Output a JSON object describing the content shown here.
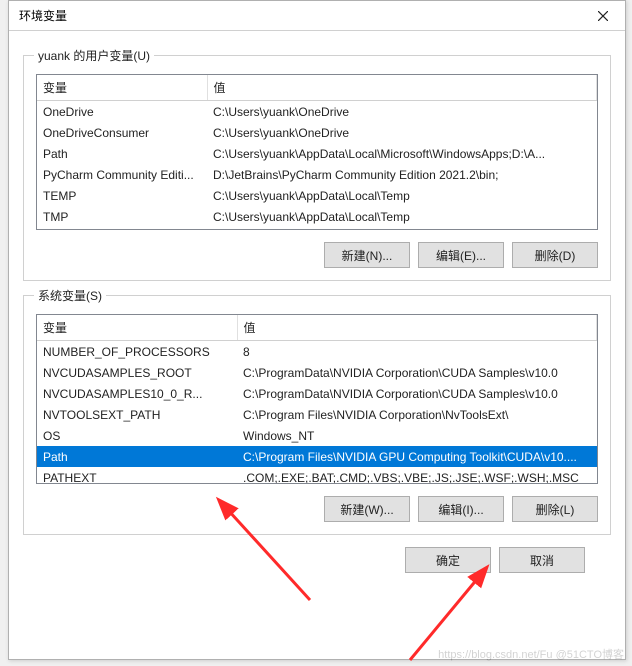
{
  "titlebar": {
    "title": "环境变量"
  },
  "userGroup": {
    "label": "yuank 的用户变量(U)",
    "headers": {
      "var": "变量",
      "val": "值"
    },
    "rows": [
      {
        "var": "OneDrive",
        "val": "C:\\Users\\yuank\\OneDrive"
      },
      {
        "var": "OneDriveConsumer",
        "val": "C:\\Users\\yuank\\OneDrive"
      },
      {
        "var": "Path",
        "val": "C:\\Users\\yuank\\AppData\\Local\\Microsoft\\WindowsApps;D:\\A..."
      },
      {
        "var": "PyCharm Community Editi...",
        "val": "D:\\JetBrains\\PyCharm Community Edition 2021.2\\bin;"
      },
      {
        "var": "TEMP",
        "val": "C:\\Users\\yuank\\AppData\\Local\\Temp"
      },
      {
        "var": "TMP",
        "val": "C:\\Users\\yuank\\AppData\\Local\\Temp"
      }
    ],
    "buttons": {
      "new": "新建(N)...",
      "edit": "编辑(E)...",
      "del": "删除(D)"
    }
  },
  "sysGroup": {
    "label": "系统变量(S)",
    "headers": {
      "var": "变量",
      "val": "值"
    },
    "rows": [
      {
        "var": "NUMBER_OF_PROCESSORS",
        "val": "8"
      },
      {
        "var": "NVCUDASAMPLES_ROOT",
        "val": "C:\\ProgramData\\NVIDIA Corporation\\CUDA Samples\\v10.0"
      },
      {
        "var": "NVCUDASAMPLES10_0_R...",
        "val": "C:\\ProgramData\\NVIDIA Corporation\\CUDA Samples\\v10.0"
      },
      {
        "var": "NVTOOLSEXT_PATH",
        "val": "C:\\Program Files\\NVIDIA Corporation\\NvToolsExt\\"
      },
      {
        "var": "OS",
        "val": "Windows_NT"
      },
      {
        "var": "Path",
        "val": "C:\\Program Files\\NVIDIA GPU Computing Toolkit\\CUDA\\v10....",
        "selected": true
      },
      {
        "var": "PATHEXT",
        "val": ".COM;.EXE;.BAT;.CMD;.VBS;.VBE;.JS;.JSE;.WSF;.WSH;.MSC"
      }
    ],
    "buttons": {
      "new": "新建(W)...",
      "edit": "编辑(I)...",
      "del": "删除(L)"
    }
  },
  "footer": {
    "ok": "确定",
    "cancel": "取消"
  },
  "watermark": "https://blog.csdn.net/Fu @51CTO博客"
}
